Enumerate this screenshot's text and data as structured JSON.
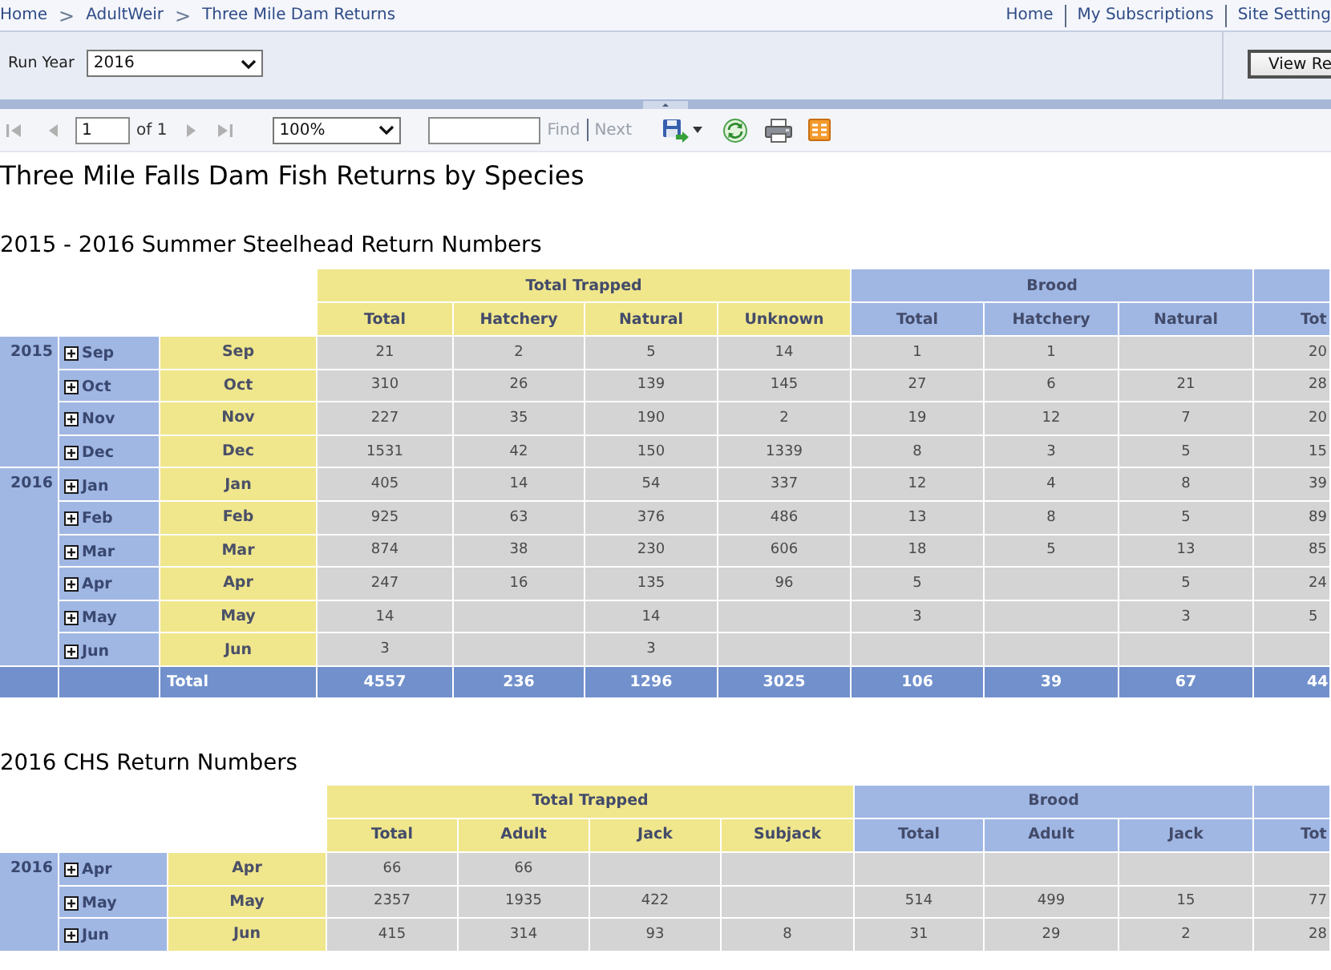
{
  "breadcrumb": {
    "items": [
      "Home",
      "AdultWeir",
      "Three Mile Dam Returns"
    ],
    "separator": ">"
  },
  "top_links": [
    "Home",
    "My Subscriptions",
    "Site Setting"
  ],
  "parameters": {
    "run_year": {
      "label": "Run Year",
      "value": "2016"
    },
    "view_button": "View Re"
  },
  "toolbar": {
    "first": {
      "disabled": true
    },
    "previous": {
      "disabled": true
    },
    "page": "1",
    "page_count": "of 1",
    "next": {
      "disabled": true
    },
    "last": {
      "disabled": true
    },
    "zoom": "100%",
    "find": {
      "label": "Find",
      "disabled": true
    },
    "find_next": {
      "label": "Next",
      "disabled": true
    }
  },
  "report": {
    "title": "Three Mile Falls Dam Fish Returns by Species",
    "tables": [
      {
        "subtitle": "2015 - 2016 Summer Steelhead Return Numbers",
        "column_groups": [
          {
            "label": "Total Trapped",
            "color": "#f0e68c",
            "columns": [
              "Total",
              "Hatchery",
              "Natural",
              "Unknown"
            ]
          },
          {
            "label": "Brood",
            "color": "#a0b7e4",
            "columns": [
              "Total",
              "Hatchery",
              "Natural"
            ]
          },
          {
            "color": "#a0b7e4",
            "columns": [
              "Tot"
            ]
          }
        ],
        "years": [
          {
            "year": "2015",
            "months": [
              {
                "toggle": "Sep",
                "expanded": false,
                "label": "Sep",
                "cells": [
                  "21",
                  "2",
                  "5",
                  "14",
                  "1",
                  "1",
                  null,
                  "20"
                ]
              },
              {
                "toggle": "Oct",
                "expanded": false,
                "label": "Oct",
                "cells": [
                  "310",
                  "26",
                  "139",
                  "145",
                  "27",
                  "6",
                  "21",
                  "28"
                ]
              },
              {
                "toggle": "Nov",
                "expanded": false,
                "label": "Nov",
                "cells": [
                  "227",
                  "35",
                  "190",
                  "2",
                  "19",
                  "12",
                  "7",
                  "20"
                ]
              },
              {
                "toggle": "Dec",
                "expanded": false,
                "label": "Dec",
                "cells": [
                  "1531",
                  "42",
                  "150",
                  "1339",
                  "8",
                  "3",
                  "5",
                  "15"
                ]
              }
            ]
          },
          {
            "year": "2016",
            "months": [
              {
                "toggle": "Jan",
                "expanded": false,
                "label": "Jan",
                "cells": [
                  "405",
                  "14",
                  "54",
                  "337",
                  "12",
                  "4",
                  "8",
                  "39"
                ]
              },
              {
                "toggle": "Feb",
                "expanded": false,
                "label": "Feb",
                "cells": [
                  "925",
                  "63",
                  "376",
                  "486",
                  "13",
                  "8",
                  "5",
                  "89"
                ]
              },
              {
                "toggle": "Mar",
                "expanded": false,
                "label": "Mar",
                "cells": [
                  "874",
                  "38",
                  "230",
                  "606",
                  "18",
                  "5",
                  "13",
                  "85"
                ]
              },
              {
                "toggle": "Apr",
                "expanded": false,
                "label": "Apr",
                "cells": [
                  "247",
                  "16",
                  "135",
                  "96",
                  "5",
                  null,
                  "5",
                  "24"
                ]
              },
              {
                "toggle": "May",
                "expanded": false,
                "label": "May",
                "cells": [
                  "14",
                  null,
                  "14",
                  null,
                  "3",
                  null,
                  "3",
                  "5"
                ]
              },
              {
                "toggle": "Jun",
                "expanded": false,
                "label": "Jun",
                "cells": [
                  "3",
                  null,
                  "3",
                  null,
                  null,
                  null,
                  null,
                  null
                ]
              }
            ]
          }
        ],
        "total": {
          "label": "Total",
          "cells": [
            "4557",
            "236",
            "1296",
            "3025",
            "106",
            "39",
            "67",
            "44"
          ]
        }
      },
      {
        "subtitle": "2016 CHS Return Numbers",
        "column_groups": [
          {
            "label": "Total Trapped",
            "color": "#f0e68c",
            "columns": [
              "Total",
              "Adult",
              "Jack",
              "Subjack"
            ]
          },
          {
            "label": "Brood",
            "color": "#a0b7e4",
            "columns": [
              "Total",
              "Adult",
              "Jack"
            ]
          },
          {
            "color": "#a0b7e4",
            "columns": [
              "Tot"
            ]
          }
        ],
        "years": [
          {
            "year": "2016",
            "months": [
              {
                "toggle": "Apr",
                "expanded": false,
                "label": "Apr",
                "cells": [
                  "66",
                  "66",
                  null,
                  null,
                  null,
                  null,
                  null,
                  null
                ]
              },
              {
                "toggle": "May",
                "expanded": false,
                "label": "May",
                "cells": [
                  "2357",
                  "1935",
                  "422",
                  null,
                  "514",
                  "499",
                  "15",
                  "77"
                ]
              },
              {
                "toggle": "Jun",
                "expanded": false,
                "label": "Jun",
                "cells": [
                  "415",
                  "314",
                  "93",
                  "8",
                  "31",
                  "29",
                  "2",
                  "28"
                ]
              }
            ]
          }
        ]
      }
    ]
  }
}
